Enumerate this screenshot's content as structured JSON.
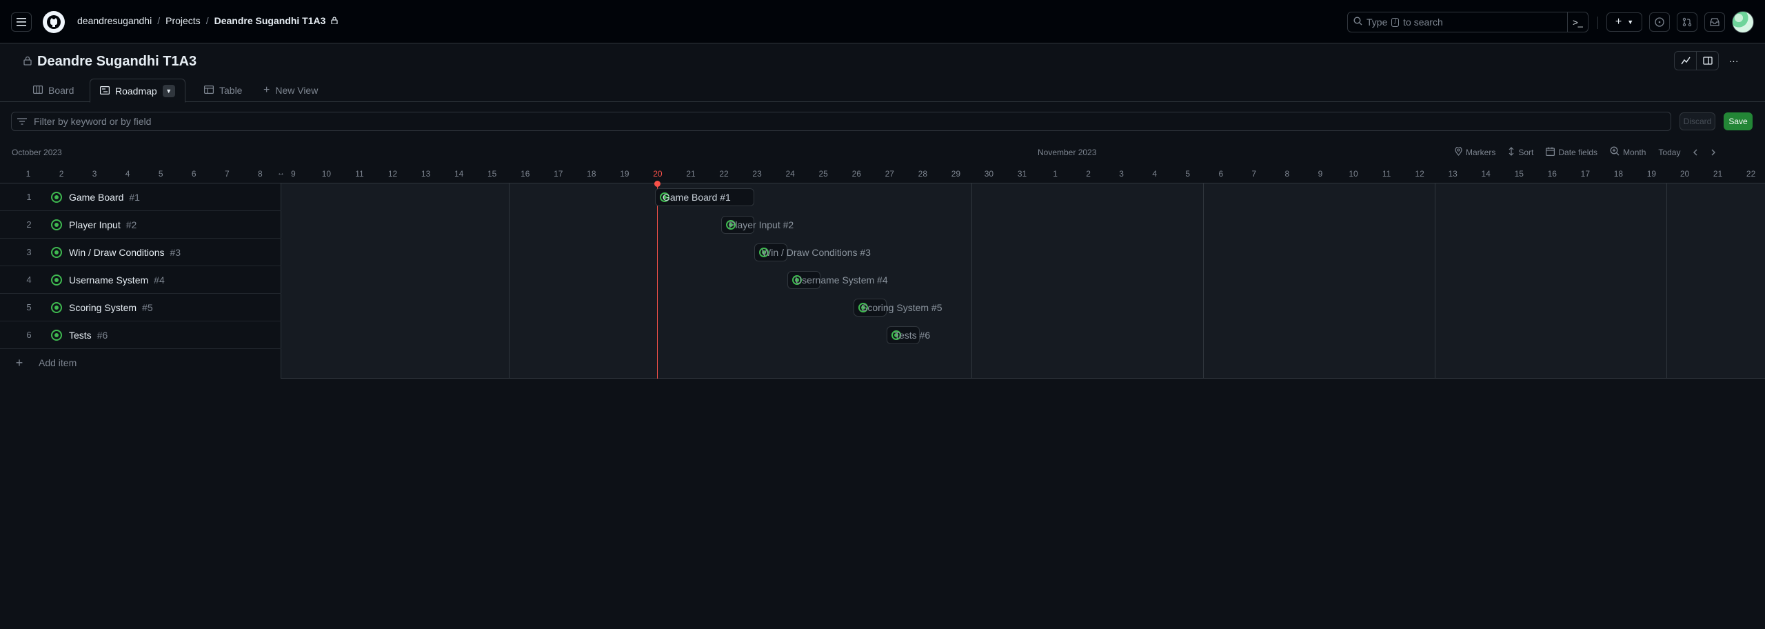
{
  "header": {
    "breadcrumb": [
      "deandresugandhi",
      "Projects",
      "Deandre Sugandhi T1A3"
    ],
    "search_placeholder": "Type",
    "search_key": "/",
    "search_suffix": "to search"
  },
  "project": {
    "title": "Deandre Sugandhi T1A3"
  },
  "tabs": [
    {
      "label": "Board"
    },
    {
      "label": "Roadmap"
    },
    {
      "label": "Table"
    },
    {
      "label": "New View"
    }
  ],
  "filter": {
    "placeholder": "Filter by keyword or by field",
    "discard_label": "Discard",
    "save_label": "Save"
  },
  "timeline": {
    "months": [
      "October 2023",
      "November 2023"
    ],
    "controls": [
      "Markers",
      "Sort",
      "Date fields",
      "Month",
      "Today"
    ],
    "today": "20",
    "days": [
      "1",
      "2",
      "3",
      "4",
      "5",
      "6",
      "7",
      "8",
      "9",
      "10",
      "11",
      "12",
      "13",
      "14",
      "15",
      "16",
      "17",
      "18",
      "19",
      "20",
      "21",
      "22",
      "23",
      "24",
      "25",
      "26",
      "27",
      "28",
      "29",
      "30",
      "31",
      "1",
      "2",
      "3",
      "4",
      "5",
      "6",
      "7",
      "8",
      "9",
      "10",
      "11",
      "12",
      "13",
      "14",
      "15",
      "16",
      "17",
      "18",
      "19",
      "20",
      "21",
      "22"
    ]
  },
  "items": [
    {
      "num": "1",
      "title": "Game Board",
      "ref": "#1",
      "bar": "Game Board #1"
    },
    {
      "num": "2",
      "title": "Player Input",
      "ref": "#2",
      "bar": "Player Input #2"
    },
    {
      "num": "3",
      "title": "Win / Draw Conditions",
      "ref": "#3",
      "bar": "Win / Draw Conditions #3"
    },
    {
      "num": "4",
      "title": "Username System",
      "ref": "#4",
      "bar": "Username System #4"
    },
    {
      "num": "5",
      "title": "Scoring System",
      "ref": "#5",
      "bar": "Scoring System #5"
    },
    {
      "num": "6",
      "title": "Tests",
      "ref": "#6",
      "bar": "Tests #6"
    }
  ],
  "add_item_label": "Add item"
}
